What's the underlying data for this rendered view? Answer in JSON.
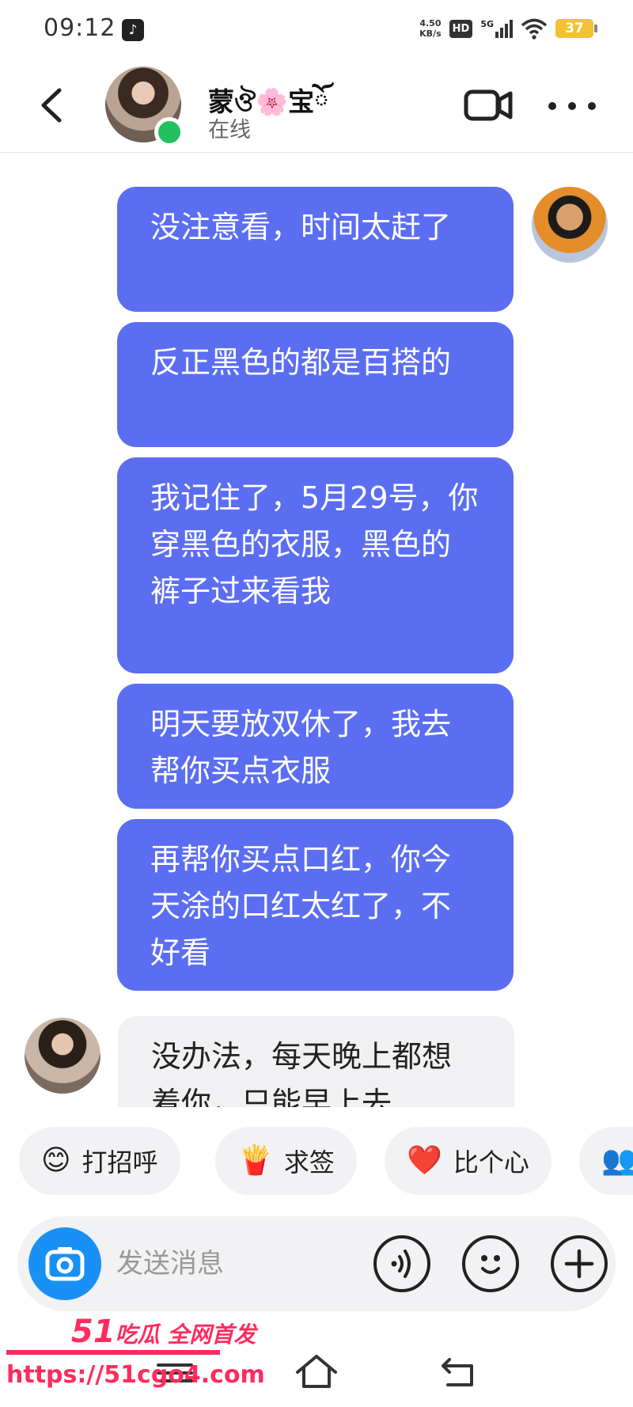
{
  "status_bar": {
    "time": "09:12",
    "net_speed_value": "4.50",
    "net_speed_unit": "KB/s",
    "hd": "HD",
    "network": "5G",
    "battery": "37"
  },
  "header": {
    "contact_name": "蒙ঔ🌸宝ོ",
    "contact_status": "在线",
    "online": true
  },
  "messages": [
    {
      "from": "me",
      "text": "没注意看，时间太赶了"
    },
    {
      "from": "me",
      "text": "反正黑色的都是百搭的"
    },
    {
      "from": "me",
      "text": "我记住了，5月29号，你穿黑色的衣服，黑色的裤子过来看我"
    },
    {
      "from": "me",
      "text": "明天要放双休了，我去帮你买点衣服"
    },
    {
      "from": "me",
      "text": "再帮你买点口红，你今天涂的口红太红了，不好看"
    },
    {
      "from": "them",
      "text": "没办法，每天晚上都想着你，只能早上去"
    }
  ],
  "quick_replies": [
    {
      "emoji": "😊",
      "label": "打招呼"
    },
    {
      "emoji": "🍟",
      "label": "求签"
    },
    {
      "emoji": "❤️",
      "label": "比个心"
    },
    {
      "emoji": "👥",
      "label": ""
    }
  ],
  "input": {
    "placeholder": "发送消息"
  },
  "watermark": {
    "line1_num": "51",
    "line1_text": "吃瓜 全网首发",
    "line2": "https://51cgo4.com"
  },
  "colors": {
    "outgoing_bubble": "#5b6ef2",
    "incoming_bubble": "#f1f1f3",
    "online": "#21c25e",
    "camera": "#1990f5",
    "watermark": "#ff2b5e",
    "battery": "#f2c232"
  }
}
